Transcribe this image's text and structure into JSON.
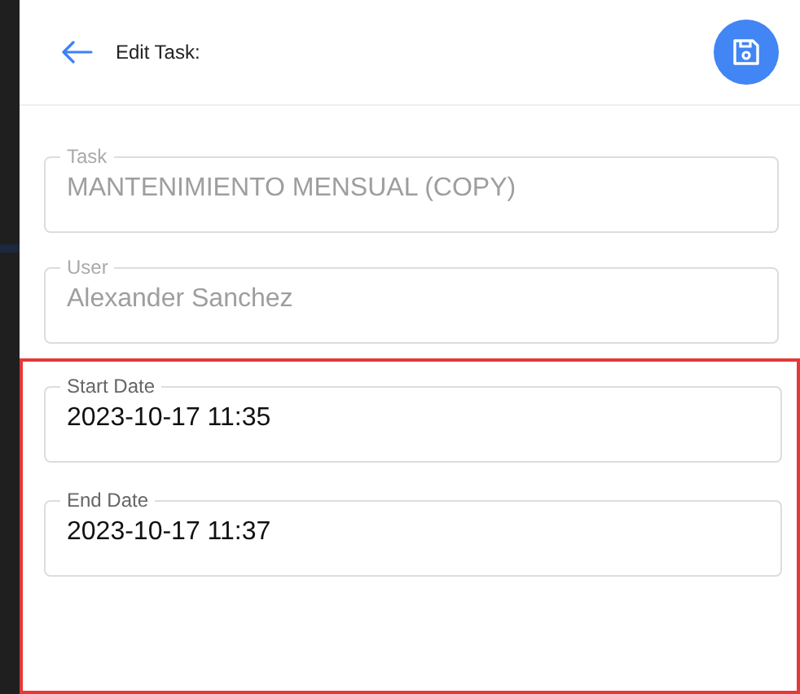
{
  "header": {
    "title": "Edit Task:"
  },
  "fields": [
    {
      "label": "Task",
      "value": "MANTENIMIENTO MENSUAL (COPY)",
      "disabled": true
    },
    {
      "label": "User",
      "value": "Alexander Sanchez",
      "disabled": true
    }
  ],
  "highlighted_group": {
    "fields": [
      {
        "label": "Start Date",
        "value": "2023-10-17 11:35",
        "disabled": false
      },
      {
        "label": "End Date",
        "value": "2023-10-17 11:37",
        "disabled": false
      }
    ]
  }
}
